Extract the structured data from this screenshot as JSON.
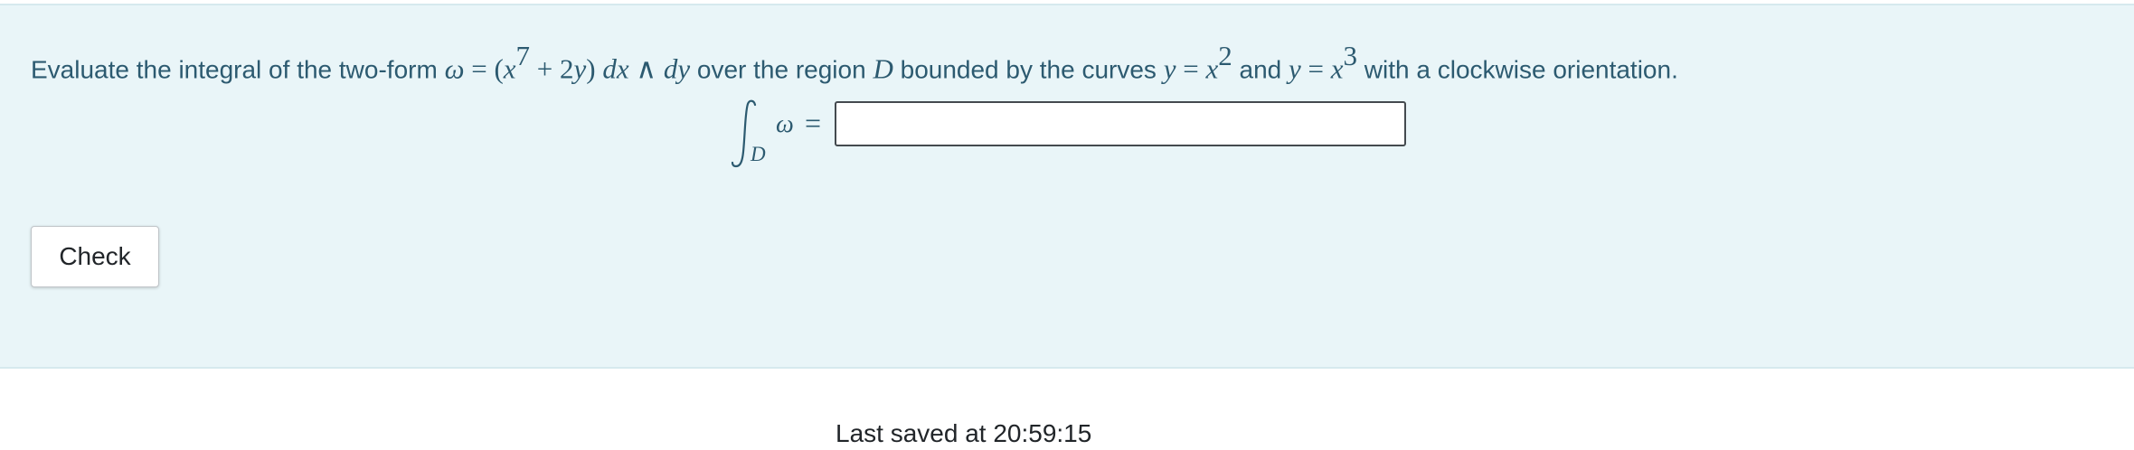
{
  "question": {
    "t1": "Evaluate the integral of the two-form ",
    "omega": "ω",
    "eq1": " = (",
    "x1": "x",
    "exp7": "7",
    "plus": " + 2",
    "y1": "y",
    "close_paren": ") ",
    "d1": "dx",
    "wedge": " ∧ ",
    "d2": "dy",
    "t2": " over the region ",
    "D": "D",
    "t3": " bounded by the curves ",
    "y2": "y",
    "eq2": " = ",
    "x2": "x",
    "exp2": "2",
    "t4": " and ",
    "y3": "y",
    "eq3": " = ",
    "x3": "x",
    "exp3": "3",
    "t5": " with a clockwise orientation."
  },
  "integral": {
    "sub": "D",
    "omega": "ω",
    "eq": "="
  },
  "answer": {
    "value": "",
    "placeholder": ""
  },
  "check_button": {
    "label": "Check"
  },
  "footer": {
    "last_saved": "Last saved at 20:59:15"
  }
}
